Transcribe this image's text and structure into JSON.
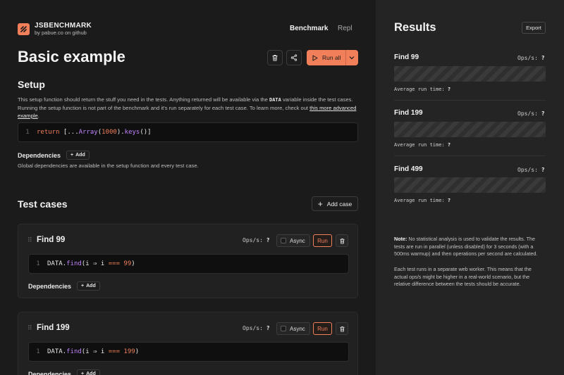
{
  "brand": {
    "name": "JSBENCHMARK",
    "tagline": "by pabue.co on github",
    "accent": "#f07f5a"
  },
  "nav": {
    "benchmark": "Benchmark",
    "repl": "Repl"
  },
  "page": {
    "title": "Basic example",
    "run_all_label": "Run all"
  },
  "setup": {
    "heading": "Setup",
    "description_1": "This setup function should return the stuff you need in the tests. Anything returned will be available via the ",
    "description_code": "DATA",
    "description_2": " variable inside the test cases. Running the setup function is not part of the benchmark and it's run separately for each test case. To learn more, check out ",
    "description_link": "this more advanced example",
    "description_end": ".",
    "code": {
      "line": "1",
      "keyword": "return",
      "pre": " [...",
      "fn": "Array",
      "mid": "(",
      "num": "1000",
      "post": ").",
      "fn2": "keys",
      "end": "()]"
    },
    "dependencies_label": "Dependencies",
    "add_label": "Add",
    "global_note": "Global dependencies are available in the setup function and every test case."
  },
  "test_cases": {
    "heading": "Test cases",
    "add_case_label": "Add case",
    "ops_label": "Ops/s:",
    "async_label": "Async",
    "run_label": "Run",
    "dependencies_label": "Dependencies",
    "add_label": "Add",
    "items": [
      {
        "name": "Find 99",
        "ops": "?",
        "code": {
          "line": "1",
          "data": "DATA",
          "dot": ".",
          "fn": "find",
          "args": "(i ⇒ i ",
          "op": "===",
          "num": "99",
          "end": ")"
        }
      },
      {
        "name": "Find 199",
        "ops": "?",
        "code": {
          "line": "1",
          "data": "DATA",
          "dot": ".",
          "fn": "find",
          "args": "(i ⇒ i ",
          "op": "===",
          "num": "199",
          "end": ")"
        }
      }
    ]
  },
  "results": {
    "title": "Results",
    "export_label": "Export",
    "ops_label": "Ops/s:",
    "avg_label": "Average run time:",
    "items": [
      {
        "name": "Find 99",
        "ops": "?",
        "avg": "?"
      },
      {
        "name": "Find 199",
        "ops": "?",
        "avg": "?"
      },
      {
        "name": "Find 499",
        "ops": "?",
        "avg": "?"
      }
    ],
    "note_bold": "Note:",
    "note_1": " No statistical analysis is used to validate the results. The tests are run in parallel (unless disabled) for 3 seconds (with a 500ms warmup) and then operations per second are calculated.",
    "note_2": "Each test runs in a separate web worker. This means that the actual ops/s might be higher in a real-world scenario, but the relative difference between the tests should be accurate."
  }
}
